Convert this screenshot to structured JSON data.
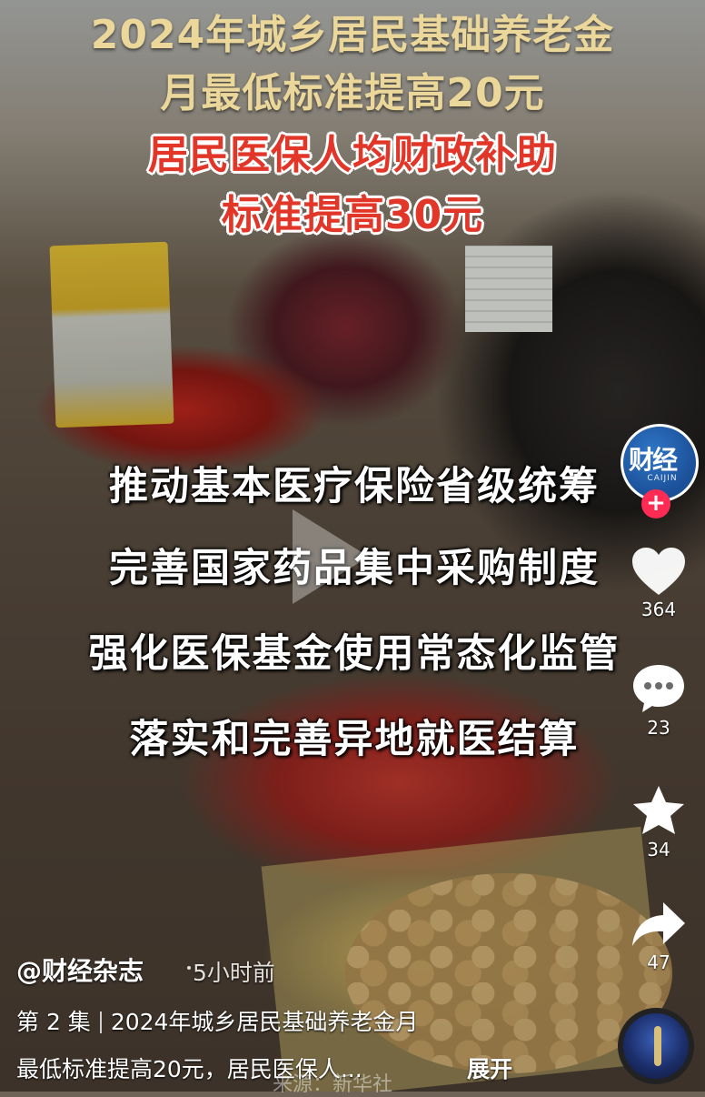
{
  "headline": {
    "line1": "2024年城乡居民基础养老金",
    "line2": "月最低标准提高20元",
    "line3": "居民医保人均财政补助",
    "line4": "标准提高30元"
  },
  "bullets": [
    "推动基本医疗保险省级统筹",
    "完善国家药品集中采购制度",
    "强化医保基金使用常态化监管",
    "落实和完善异地就医结算"
  ],
  "channel_logo": {
    "text": "财经",
    "sub": "CAIJIN",
    "follow_symbol": "+"
  },
  "actions": {
    "like_count": "364",
    "comment_count": "23",
    "favorite_count": "34",
    "share_count": "47"
  },
  "post": {
    "author": "@财经杂志",
    "time": "5小时前",
    "episode": "第 2 集",
    "desc_line1": "2024年城乡居民基础养老金月",
    "desc_line2": "最低标准提高20元，居民医保人...",
    "expand_label": "展开"
  },
  "watermark": "来源：新华社",
  "icons": {
    "play": "play-icon",
    "like": "heart-icon",
    "comment": "comment-icon",
    "favorite": "star-icon",
    "share": "share-arrow-icon",
    "music": "music-disc-icon"
  }
}
